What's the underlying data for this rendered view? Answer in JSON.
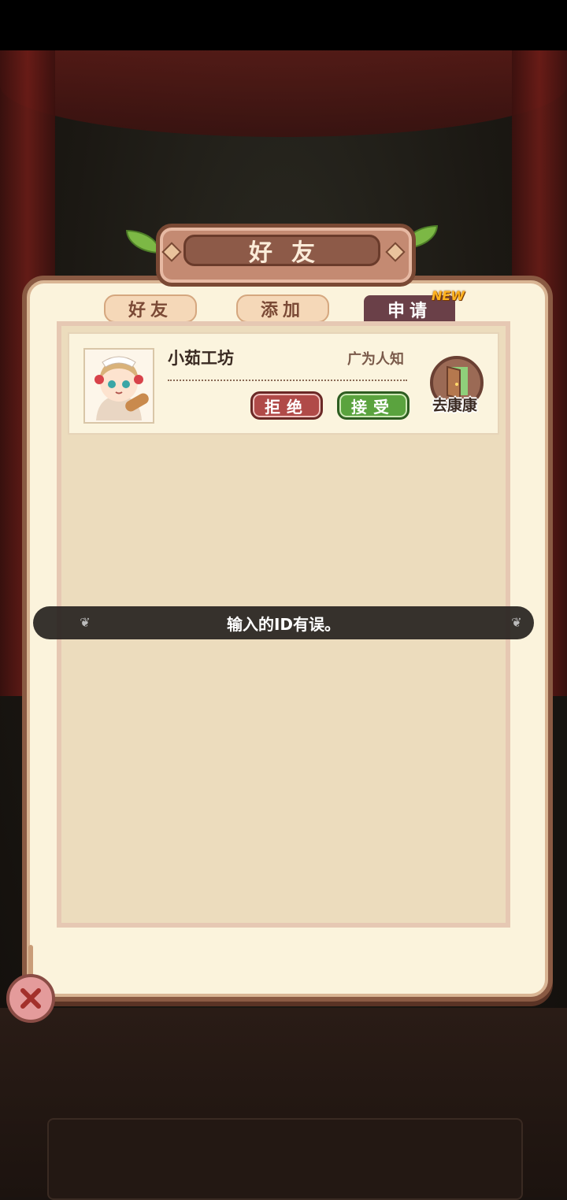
{
  "title": "好友",
  "tabs": [
    {
      "label": "好友"
    },
    {
      "label": "添加"
    },
    {
      "label": "申请"
    }
  ],
  "new_badge": "NEW",
  "request": {
    "name": "小茹工坊",
    "rank": "广为人知",
    "reject_label": "拒绝",
    "accept_label": "接受",
    "visit_label": "去康康"
  },
  "toast": "输入的ID有误。",
  "icons": {
    "close": "close-icon",
    "visit": "door-icon",
    "avatar": "maid-avatar"
  },
  "colors": {
    "reject": "#b04a48",
    "accept": "#5aa33e",
    "active_tab": "#6a4048",
    "badge": "#ffb320"
  }
}
